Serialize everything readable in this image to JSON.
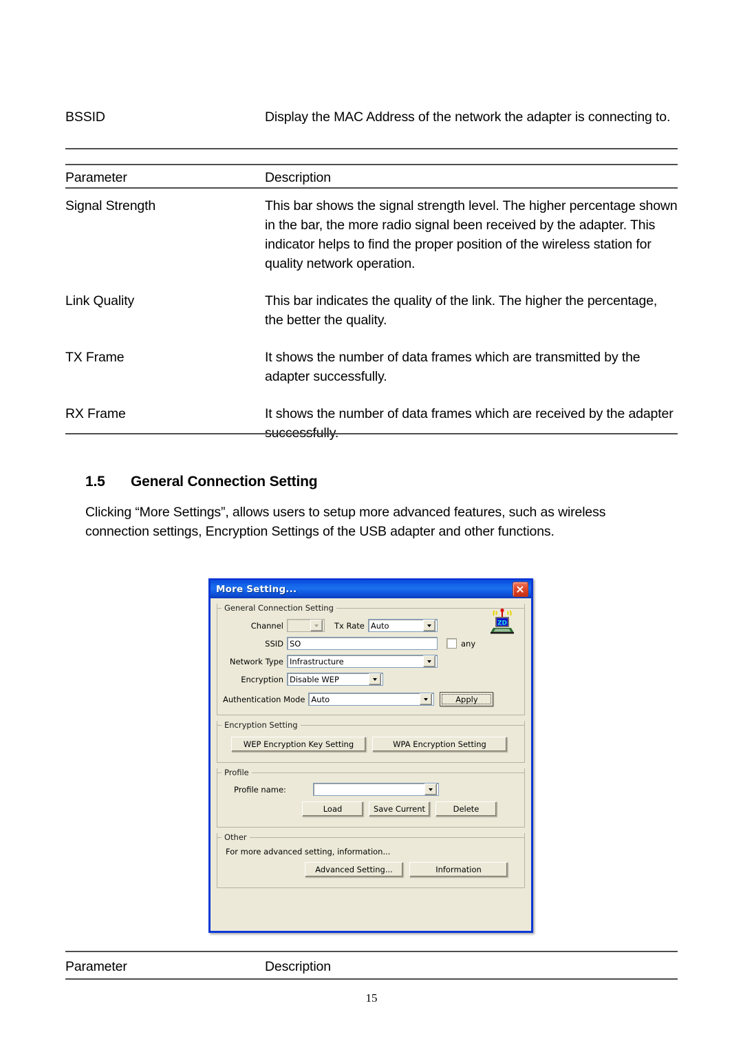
{
  "document": {
    "top_table": {
      "rows": [
        {
          "parameter": "BSSID",
          "description": "Display the MAC Address of the network the adapter is connecting to."
        }
      ]
    },
    "table_header": {
      "parameter": "Parameter",
      "description": "Description"
    },
    "table_rows": [
      {
        "parameter": "Signal Strength",
        "description": "This bar shows the signal strength level. The higher percentage shown in the bar, the more radio signal been received by the adapter. This indicator helps to find the proper position of the wireless station for quality network operation."
      },
      {
        "parameter": "Link Quality",
        "description": "This bar indicates the quality of the link. The higher the percentage, the better the quality."
      },
      {
        "parameter": "TX Frame",
        "description": "It shows the number of data frames which are transmitted by the adapter successfully."
      },
      {
        "parameter": "RX Frame",
        "description": "It shows the number of data frames which are received by the adapter successfully."
      }
    ],
    "section": {
      "number": "1.5",
      "title": "General Connection Setting",
      "paragraph": "Clicking “More Settings”, allows users to setup more advanced features, such as wireless connection settings, Encryption Settings of the USB adapter and other functions."
    },
    "bottom_table_header": {
      "parameter": "Parameter",
      "description": "Description"
    },
    "page_number": "15"
  },
  "dialog": {
    "title": "More Setting...",
    "close_label": "close-icon",
    "accent_color": "#0a38d6",
    "face_color": "#ece9d8",
    "groups": {
      "general": {
        "legend": "General Connection Setting",
        "channel_label": "Channel",
        "channel_value": "",
        "channel_disabled": true,
        "tx_rate_label": "Tx Rate",
        "tx_rate_value": "Auto",
        "ssid_label": "SSID",
        "ssid_value": "SO",
        "any_label": "any",
        "any_checked": false,
        "network_type_label": "Network Type",
        "network_type_value": "Infrastructure",
        "encryption_label": "Encryption",
        "encryption_value": "Disable WEP",
        "auth_mode_label": "Authentication Mode",
        "auth_mode_value": "Auto",
        "apply_label": "Apply",
        "icon_name": "wireless-laptop-zd-icon",
        "icon_text": "ZD"
      },
      "encryption": {
        "legend": "Encryption Setting",
        "wep_button": "WEP Encryption Key Setting",
        "wpa_button": "WPA Encryption Setting"
      },
      "profile": {
        "legend": "Profile",
        "profile_name_label": "Profile name:",
        "profile_name_value": "",
        "load_button": "Load",
        "save_button": "Save Current",
        "delete_button": "Delete"
      },
      "other": {
        "legend": "Other",
        "note": "For more advanced setting, information...",
        "advanced_button": "Advanced Setting...",
        "information_button": "Information"
      }
    }
  }
}
